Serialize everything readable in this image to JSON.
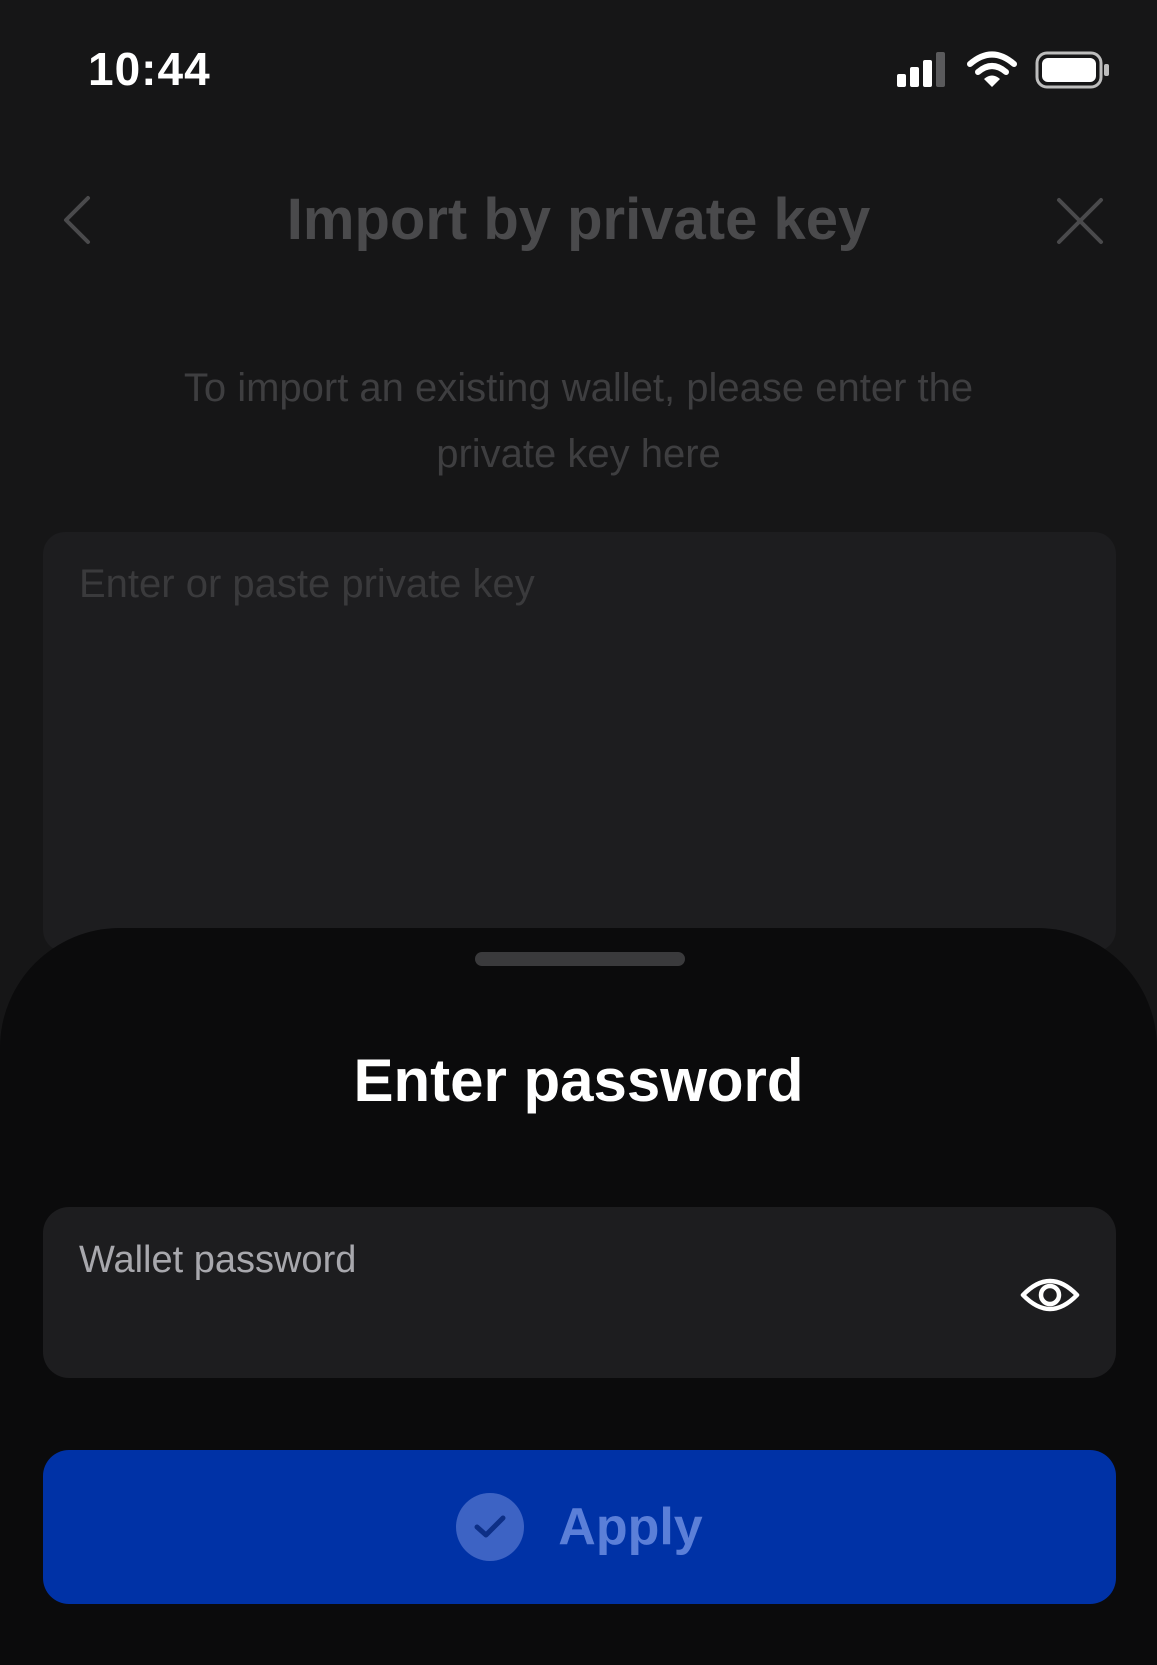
{
  "status_bar": {
    "time": "10:44"
  },
  "background_page": {
    "title": "Import by private key",
    "subtitle_line1": "To import an existing wallet, please enter the",
    "subtitle_line2": "private key here",
    "input_placeholder": "Enter or paste private key",
    "icons": {
      "back": "chevron-left-icon",
      "close": "close-icon"
    }
  },
  "sheet": {
    "title": "Enter password",
    "password_field": {
      "label": "Wallet password",
      "value": ""
    },
    "apply_label": "Apply",
    "icons": {
      "visibility": "eye-icon",
      "apply": "check-circle-icon"
    }
  },
  "colors": {
    "background": "#161617",
    "sheet": "#0b0b0c",
    "field": "#1d1d1f",
    "primary": "#0032a6",
    "primary_disabled_text": "#5b7fd8"
  }
}
